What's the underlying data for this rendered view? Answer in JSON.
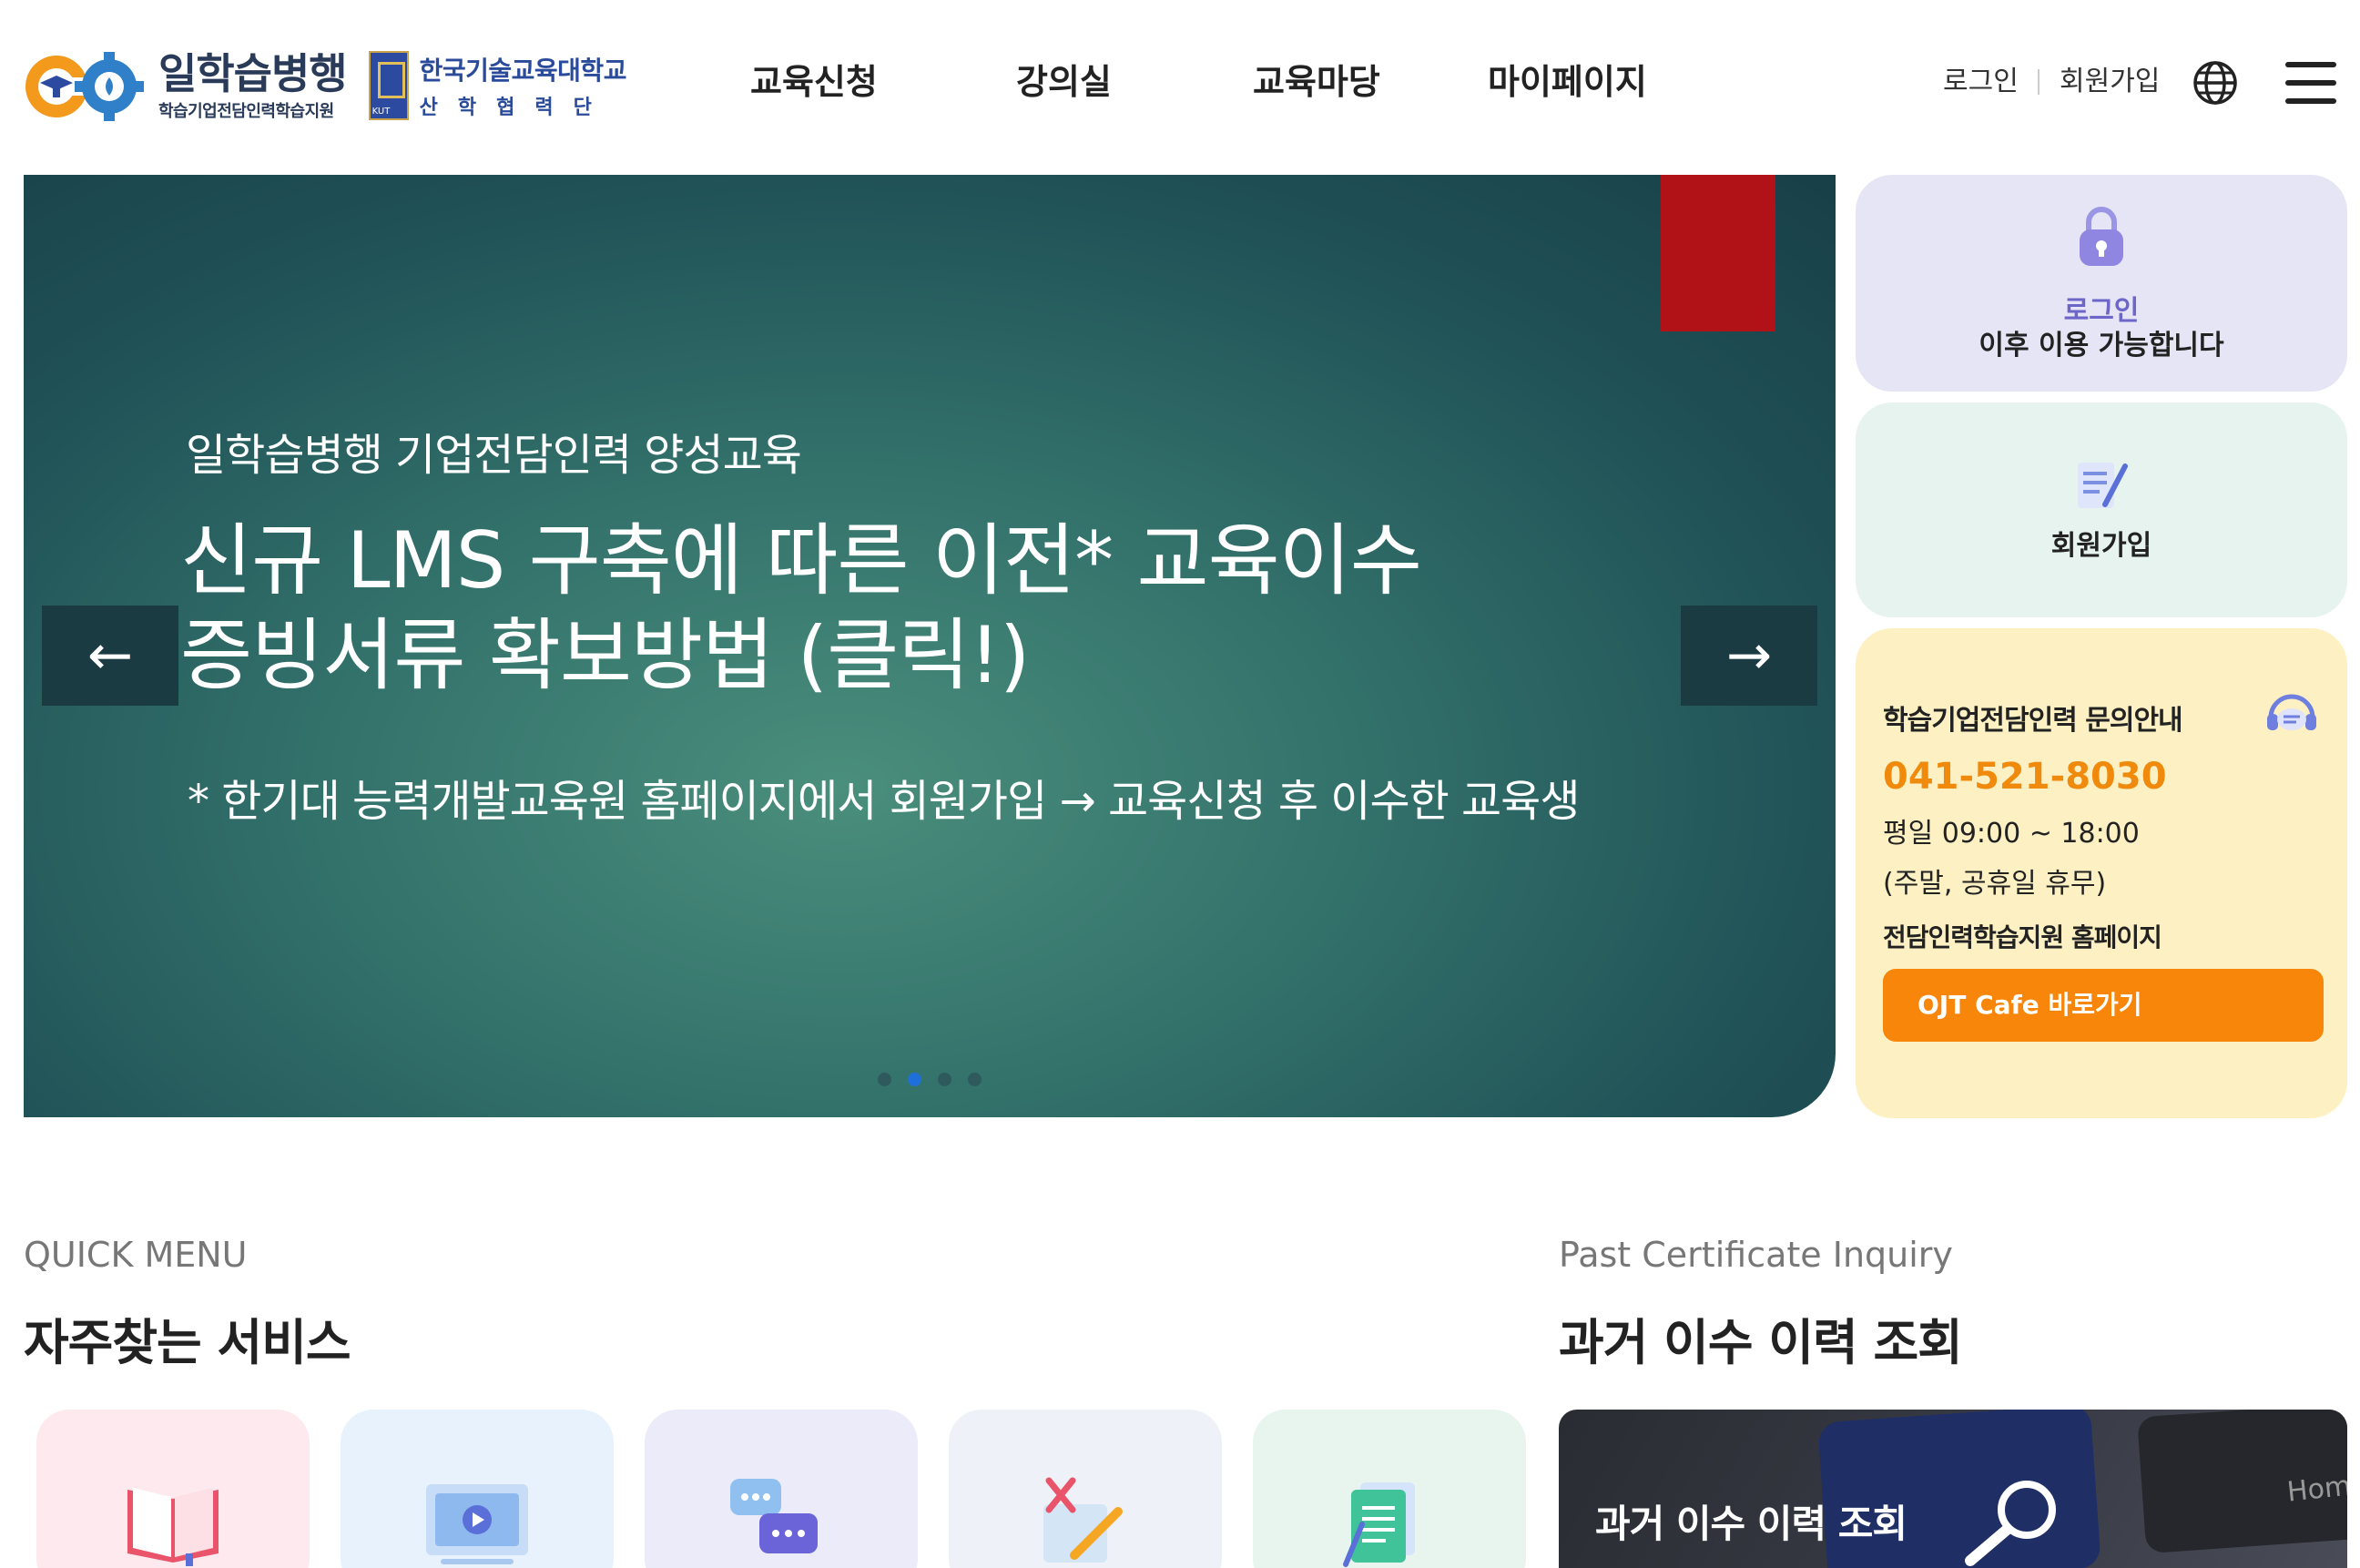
{
  "header": {
    "logo_main": "일학습병행",
    "logo_sub": "학습기업전담인력학습지원",
    "partner_main": "한국기술교육대학교",
    "partner_sub": "산학협력단",
    "partner_emblem_text": "KUT",
    "nav": [
      {
        "label": "교육신청"
      },
      {
        "label": "강의실"
      },
      {
        "label": "교육마당"
      },
      {
        "label": "마이페이지"
      }
    ],
    "util": {
      "login": "로그인",
      "join": "회원가입"
    }
  },
  "hero": {
    "kicker": "일학습병행 기업전담인력 양성교육",
    "headline_1": "신규 LMS 구축에 따른 이전* 교육이수",
    "headline_2": "증빙서류 확보방법 (클릭!)",
    "note": "* 한기대 능력개발교육원 홈페이지에서 회원가입 → 교육신청 후 이수한 교육생",
    "prev_arrow": "←",
    "next_arrow": "→",
    "slide_count": 4,
    "active_slide": 2
  },
  "side": {
    "login_highlight": "로그인",
    "login_text": "이후 이용 가능합니다",
    "join_label": "회원가입",
    "inquiry_title": "학습기업전담인력 문의안내",
    "inquiry_phone": "041-521-8030",
    "inquiry_hours": "평일 09:00 ~ 18:00",
    "inquiry_closed": "(주말, 공휴일 휴무)",
    "inquiry_site": "전담인력학습지원 홈페이지",
    "inquiry_button": "OJT Cafe 바로가기"
  },
  "quick": {
    "sub": "QUICK MENU",
    "title": "자주찾는 서비스",
    "cards": [
      {
        "icon": "book-icon",
        "bg": "#fde9ee"
      },
      {
        "icon": "video-lecture-icon",
        "bg": "#e8f2fd"
      },
      {
        "icon": "chat-bubbles-icon",
        "bg": "#ecebfa"
      },
      {
        "icon": "quiz-icon",
        "bg": "#eef2f8"
      },
      {
        "icon": "document-icon",
        "bg": "#e8f5ee"
      }
    ]
  },
  "past": {
    "sub": "Past Certificate Inquiry",
    "title": "과거 이수 이력 조회",
    "card_label": "과거 이수 이력 조회",
    "keyboard_text": "Hom"
  },
  "colors": {
    "accent_orange": "#f7860b",
    "phone_orange": "#f08a0c",
    "login_purple": "#6c66c9",
    "hero_teal": "#34736c",
    "hero_red": "#b01217"
  }
}
